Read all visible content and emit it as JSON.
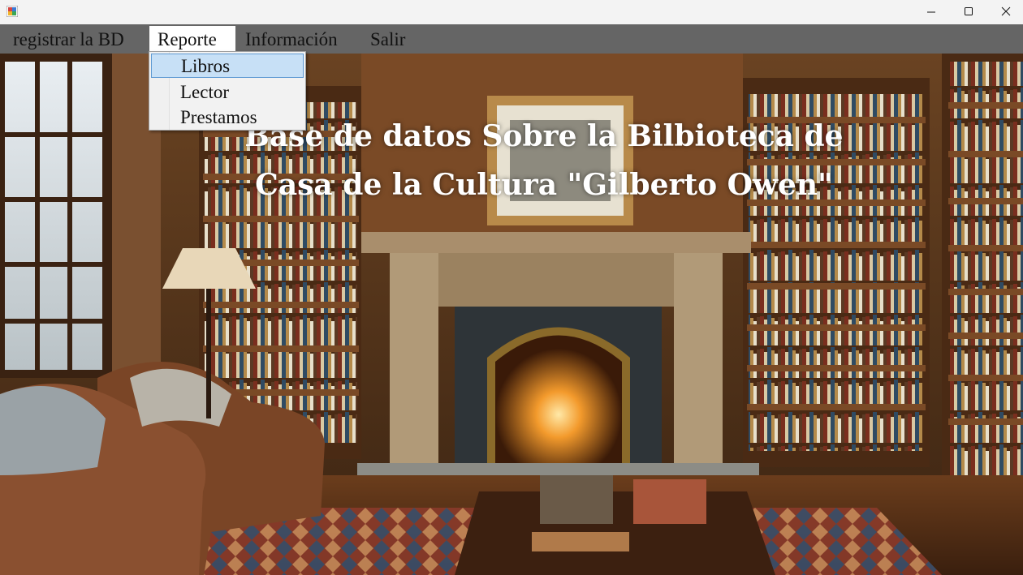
{
  "window": {
    "controls": {
      "minimize": "minimize-icon",
      "maximize": "maximize-icon",
      "close": "close-icon"
    }
  },
  "menu": [
    {
      "label": "registrar la BD"
    },
    {
      "label": "Reporte"
    },
    {
      "label": "Información"
    },
    {
      "label": "Salir"
    }
  ],
  "dropdown": {
    "items": [
      {
        "label": "Libros",
        "highlighted": true
      },
      {
        "label": "Lector"
      },
      {
        "label": "Prestamos"
      }
    ]
  },
  "main": {
    "heading_line1": "Base de datos Sobre la Bilbioteca de",
    "heading_line2": "Casa de la Cultura \"Gilberto Owen\""
  },
  "colors": {
    "menubar": "#656565",
    "titlebar": "#f3f3f3",
    "highlight": "#c7e0f6",
    "highlight_border": "#5e9ad3"
  }
}
